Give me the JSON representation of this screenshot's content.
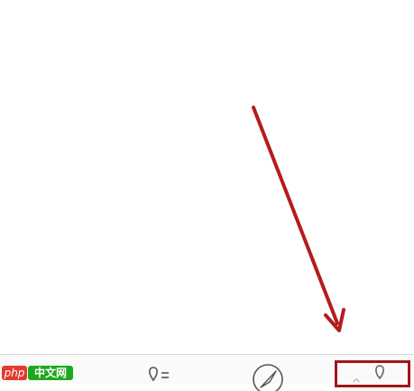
{
  "watermark": {
    "php_text": "php",
    "cn_text": "中文网"
  },
  "tabbar": {
    "tabs": [
      {
        "name": "tab-recognize",
        "icon": "pin-list-icon"
      },
      {
        "name": "tab-discover",
        "icon": "compass-icon"
      },
      {
        "name": "tab-profile",
        "icon": "profile-icon"
      }
    ]
  },
  "annotation": {
    "arrow_color": "#b41d1d",
    "highlight_color": "#a31515",
    "target": "tab-profile"
  }
}
